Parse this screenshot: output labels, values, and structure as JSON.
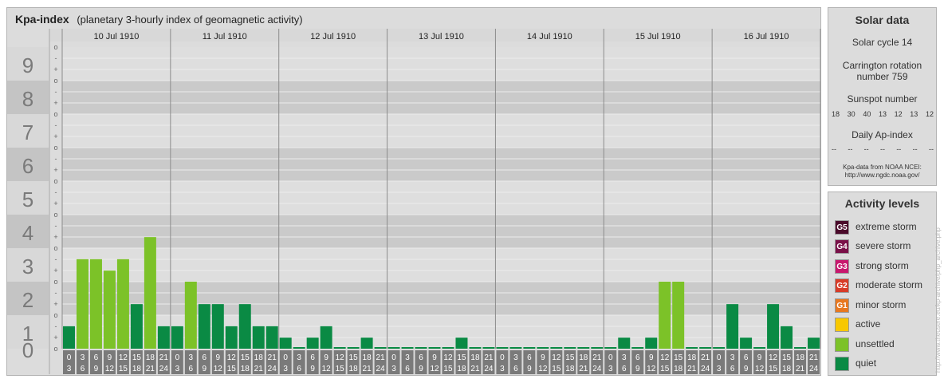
{
  "header": {
    "title": "Kpa-index",
    "subtitle": "(planetary 3-hourly index of geomagnetic activity)"
  },
  "solar": {
    "title": "Solar data",
    "cycle": "Solar cycle 14",
    "carrington_line1": "Carrington rotation",
    "carrington_line2": "number 759",
    "sunspot_label": "Sunspot number",
    "sunspot_values": [
      "18",
      "30",
      "40",
      "13",
      "12",
      "13",
      "12"
    ],
    "ap_label": "Daily Ap-index",
    "ap_values": [
      "--",
      "--",
      "--",
      "--",
      "--",
      "--",
      "--"
    ],
    "source_line1": "Kpa-data from NOAA NCEI:",
    "source_line2": "http://www.ngdc.noaa.gov/"
  },
  "levels": {
    "title": "Activity levels",
    "items": [
      {
        "badge": "G5",
        "label": "extreme storm",
        "color": "#4a0a2a"
      },
      {
        "badge": "G4",
        "label": "severe storm",
        "color": "#7a1048"
      },
      {
        "badge": "G3",
        "label": "strong storm",
        "color": "#c8186e"
      },
      {
        "badge": "G2",
        "label": "moderate storm",
        "color": "#d83c28"
      },
      {
        "badge": "G1",
        "label": "minor storm",
        "color": "#e87820"
      },
      {
        "badge": "",
        "label": "active",
        "color": "#f8c800"
      },
      {
        "badge": "",
        "label": "unsettled",
        "color": "#7cc228"
      },
      {
        "badge": "",
        "label": "quiet",
        "color": "#0a8a44"
      }
    ]
  },
  "watermark": "http://www.theusere.eu/kp-archive/php_archive.php",
  "chart_data": {
    "type": "bar",
    "title": "Kpa-index",
    "subtitle": "(planetary 3-hourly index of geomagnetic activity)",
    "ylim": [
      0,
      9
    ],
    "y_ticks": [
      "0",
      "1",
      "2",
      "3",
      "4",
      "5",
      "6",
      "7",
      "8",
      "9"
    ],
    "minor_ticks": [
      "o",
      "+",
      "-"
    ],
    "days": [
      "10 Jul 1910",
      "11 Jul 1910",
      "12 Jul 1910",
      "13 Jul 1910",
      "14 Jul 1910",
      "15 Jul 1910",
      "16 Jul 1910"
    ],
    "hour_labels_top": [
      "0",
      "3",
      "6",
      "9",
      "12",
      "15",
      "18",
      "21"
    ],
    "hour_labels_bottom": [
      "3",
      "6",
      "9",
      "12",
      "15",
      "18",
      "21",
      "24"
    ],
    "colors": {
      "quiet": "#0a8a44",
      "unsettled": "#7cc228",
      "active": "#f8c800"
    },
    "series": [
      {
        "day": "10 Jul 1910",
        "values": [
          0.67,
          2.67,
          2.67,
          2.33,
          2.67,
          1.33,
          3.33,
          0.67
        ]
      },
      {
        "day": "11 Jul 1910",
        "values": [
          0.67,
          2.0,
          1.33,
          1.33,
          0.67,
          1.33,
          0.67,
          0.67
        ]
      },
      {
        "day": "12 Jul 1910",
        "values": [
          0.33,
          0.0,
          0.33,
          0.67,
          0.0,
          0.0,
          0.33,
          0.0
        ]
      },
      {
        "day": "13 Jul 1910",
        "values": [
          0.0,
          0.0,
          0.0,
          0.0,
          0.0,
          0.33,
          0.0,
          0.0
        ]
      },
      {
        "day": "14 Jul 1910",
        "values": [
          0.0,
          0.0,
          0.0,
          0.0,
          0.0,
          0.0,
          0.0,
          0.0
        ]
      },
      {
        "day": "15 Jul 1910",
        "values": [
          0.0,
          0.33,
          0.0,
          0.33,
          2.0,
          2.0,
          0.0,
          0.0
        ]
      },
      {
        "day": "16 Jul 1910",
        "values": [
          0.0,
          1.33,
          0.33,
          0.0,
          1.33,
          0.67,
          0.0,
          0.33
        ]
      }
    ]
  }
}
